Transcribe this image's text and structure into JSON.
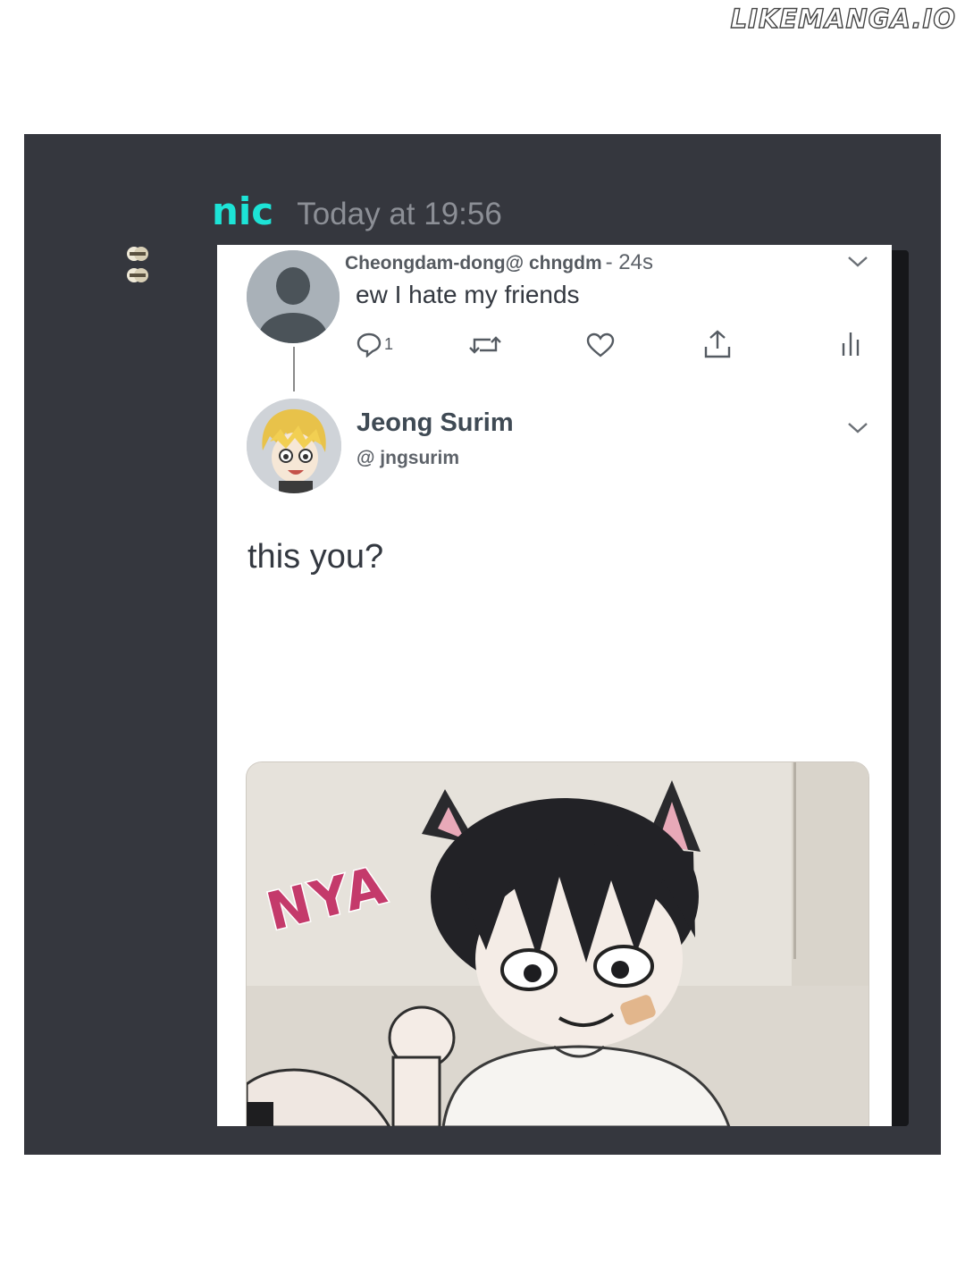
{
  "watermark": "LIKEMANGA.IO",
  "message": {
    "author": "nic",
    "timestamp": "Today at 19:56"
  },
  "embed": {
    "parent_tweet": {
      "handle_line": "Cheongdam-dong@ chngdm",
      "time": "- 24s",
      "text": "ew I hate my friends",
      "reply_count": "1"
    },
    "reply_tweet": {
      "display_name": "Jeong Surim",
      "handle": "@ jngsurim",
      "text": "this you?",
      "media_text": "NYA"
    }
  },
  "icons": [
    "app-icon",
    "default-avatar-icon",
    "chevron-down-icon",
    "reply-icon",
    "retweet-icon",
    "like-icon",
    "share-icon",
    "analytics-icon"
  ],
  "colors": {
    "panel_bg": "#35373e",
    "author": "#1de3d6",
    "timestamp": "#8c8f96",
    "media_text": "#c43a6b"
  }
}
